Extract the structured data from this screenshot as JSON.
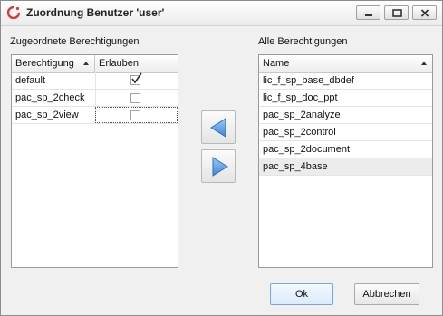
{
  "window": {
    "title": "Zuordnung Benutzer 'user'",
    "icon": "app-logo-icon"
  },
  "left_panel": {
    "label": "Zugeordnete Berechtigungen",
    "columns": [
      "Berechtigung",
      "Erlauben"
    ],
    "sort_column": "Berechtigung",
    "rows": [
      {
        "name": "default",
        "allowed": true
      },
      {
        "name": "pac_sp_2check",
        "allowed": false
      },
      {
        "name": "pac_sp_2view",
        "allowed": false
      }
    ]
  },
  "right_panel": {
    "label": "Alle Berechtigungen",
    "columns": [
      "Name"
    ],
    "sort_column": "Name",
    "rows": [
      "lic_f_sp_base_dbdef",
      "lic_f_sp_doc_ppt",
      "pac_sp_2analyze",
      "pac_sp_2control",
      "pac_sp_2document",
      "pac_sp_4base"
    ]
  },
  "buttons": {
    "ok": "Ok",
    "cancel": "Abbrechen"
  },
  "colors": {
    "arrow": "#4a90e2",
    "check": "#2a2a2a"
  }
}
